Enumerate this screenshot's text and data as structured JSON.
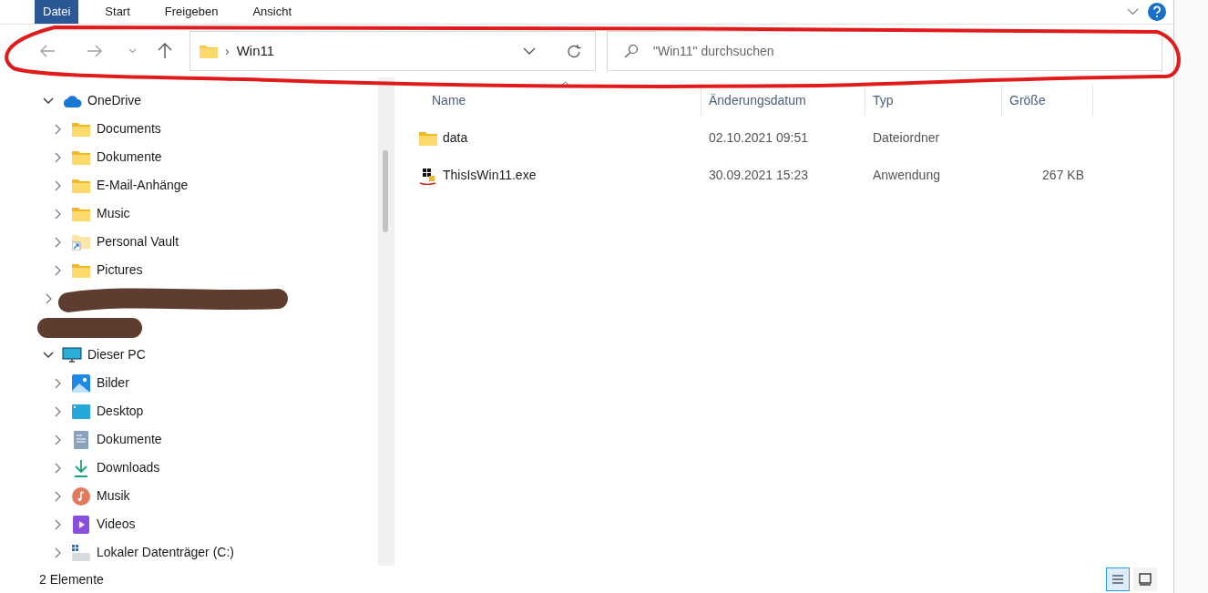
{
  "ribbon": {
    "tabs": [
      {
        "label": "Datei",
        "selected": true
      },
      {
        "label": "Start",
        "selected": false
      },
      {
        "label": "Freigeben",
        "selected": false
      },
      {
        "label": "Ansicht",
        "selected": false
      }
    ]
  },
  "address_bar": {
    "breadcrumb_separator": "›",
    "path": "Win11"
  },
  "search": {
    "placeholder": "\"Win11\" durchsuchen"
  },
  "sidebar": {
    "items": [
      {
        "label": "OneDrive",
        "kind": "cloud",
        "expanded": true,
        "children": [
          {
            "label": "Documents",
            "kind": "folder",
            "expanded": false
          },
          {
            "label": "Dokumente",
            "kind": "folder",
            "expanded": false
          },
          {
            "label": "E-Mail-Anhänge",
            "kind": "folder",
            "expanded": false
          },
          {
            "label": "Music",
            "kind": "folder",
            "expanded": false
          },
          {
            "label": "Personal Vault",
            "kind": "shortcut",
            "expanded": false
          },
          {
            "label": "Pictures",
            "kind": "folder",
            "expanded": false
          }
        ]
      },
      {
        "kind": "redacted",
        "expanded": false
      },
      {
        "kind": "redacted"
      },
      {
        "label": "Dieser PC",
        "kind": "pc",
        "expanded": true,
        "children": [
          {
            "label": "Bilder",
            "kind": "pictures",
            "expanded": false
          },
          {
            "label": "Desktop",
            "kind": "desktop",
            "expanded": false
          },
          {
            "label": "Dokumente",
            "kind": "documents",
            "expanded": false
          },
          {
            "label": "Downloads",
            "kind": "downloads",
            "expanded": false
          },
          {
            "label": "Musik",
            "kind": "music",
            "expanded": false
          },
          {
            "label": "Videos",
            "kind": "videos",
            "expanded": false
          },
          {
            "label": "Lokaler Datenträger (C:)",
            "kind": "drive",
            "expanded": false
          }
        ]
      }
    ]
  },
  "table": {
    "columns": [
      "Name",
      "Änderungsdatum",
      "Typ",
      "Größe"
    ],
    "rows": [
      {
        "kind": "folder",
        "cells": [
          "data",
          "02.10.2021 09:51",
          "Dateiordner",
          ""
        ]
      },
      {
        "kind": "exe",
        "cells": [
          "ThisIsWin11.exe",
          "30.09.2021 15:23",
          "Anwendung",
          "267 KB"
        ]
      }
    ]
  },
  "status_bar": {
    "count": "2 Elemente",
    "views": [
      {
        "kind": "details",
        "selected": true
      },
      {
        "kind": "tiles",
        "selected": false
      }
    ]
  },
  "annotations": [
    {
      "kind": "ring"
    },
    {
      "kind": "scribble"
    },
    {
      "kind": "scribble"
    }
  ]
}
